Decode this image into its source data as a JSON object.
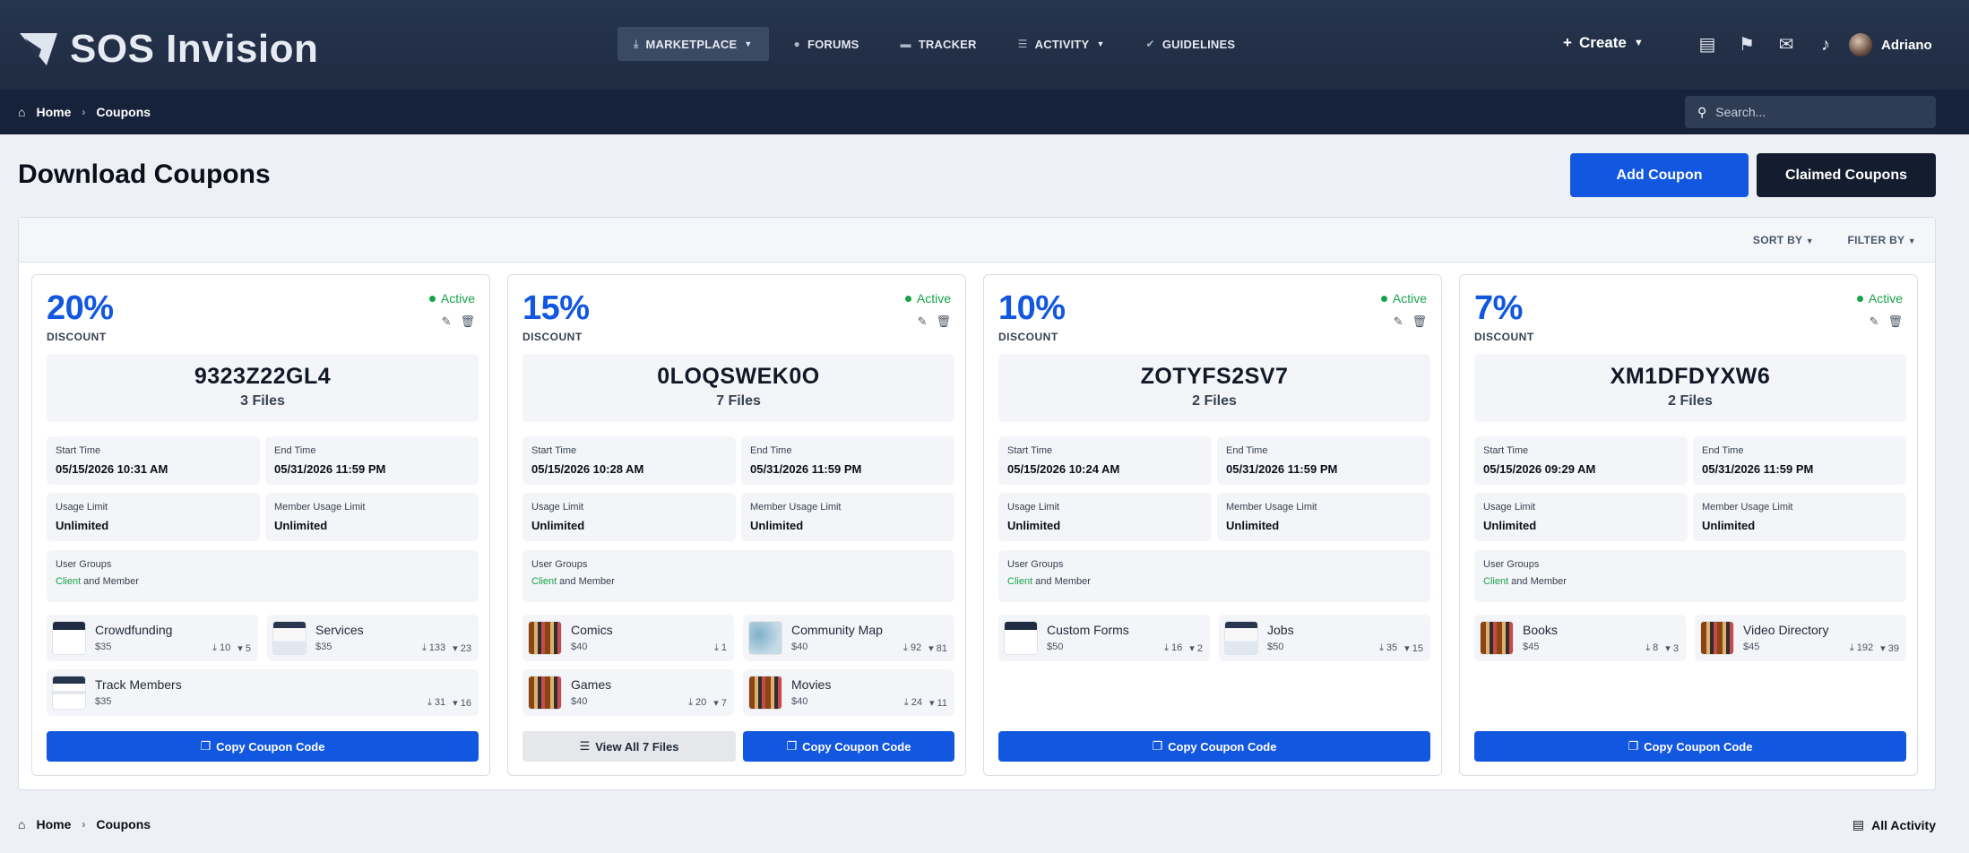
{
  "header": {
    "brand": "SOS Invision",
    "nav": [
      {
        "label": "MARKETPLACE",
        "icon": "download-icon",
        "has_caret": true
      },
      {
        "label": "FORUMS",
        "icon": "comment-icon",
        "has_caret": false
      },
      {
        "label": "TRACKER",
        "icon": "folder-icon",
        "has_caret": false
      },
      {
        "label": "ACTIVITY",
        "icon": "list-icon",
        "has_caret": true
      },
      {
        "label": "GUIDELINES",
        "icon": "check-badge-icon",
        "has_caret": false
      }
    ],
    "create_label": "Create",
    "user_name": "Adriano"
  },
  "breadcrumb": {
    "home": "Home",
    "current": "Coupons"
  },
  "search": {
    "placeholder": "Search..."
  },
  "page": {
    "title": "Download Coupons",
    "add_label": "Add Coupon",
    "claimed_label": "Claimed Coupons"
  },
  "toolbar": {
    "sort_label": "SORT BY",
    "filter_label": "FILTER BY"
  },
  "labels": {
    "discount": "DISCOUNT",
    "start_time": "Start Time",
    "end_time": "End Time",
    "usage_limit": "Usage Limit",
    "member_usage_limit": "Member Usage Limit",
    "user_groups": "User Groups",
    "groups_client": "Client",
    "groups_rest": " and Member",
    "copy": "Copy Coupon Code",
    "view_all": "View All 7 Files"
  },
  "coupons": [
    {
      "percent": "20%",
      "status": "Active",
      "code": "9323Z22GL4",
      "files": "3 Files",
      "start": "05/15/2026 10:31 AM",
      "end": "05/31/2026 11:59 PM",
      "usage": "Unlimited",
      "member_usage": "Unlimited",
      "items": [
        {
          "name": "Crowdfunding",
          "price": "$35",
          "downloads": "10",
          "purchases": "5"
        },
        {
          "name": "Services",
          "price": "$35",
          "downloads": "133",
          "purchases": "23"
        },
        {
          "name": "Track Members",
          "price": "$35",
          "downloads": "31",
          "purchases": "16"
        }
      ]
    },
    {
      "percent": "15%",
      "status": "Active",
      "code": "0LOQSWEK0O",
      "files": "7 Files",
      "start": "05/15/2026 10:28 AM",
      "end": "05/31/2026 11:59 PM",
      "usage": "Unlimited",
      "member_usage": "Unlimited",
      "items": [
        {
          "name": "Comics",
          "price": "$40",
          "downloads": "1",
          "purchases": ""
        },
        {
          "name": "Community Map",
          "price": "$40",
          "downloads": "92",
          "purchases": "81"
        },
        {
          "name": "Games",
          "price": "$40",
          "downloads": "20",
          "purchases": "7"
        },
        {
          "name": "Movies",
          "price": "$40",
          "downloads": "24",
          "purchases": "11"
        }
      ]
    },
    {
      "percent": "10%",
      "status": "Active",
      "code": "ZOTYFS2SV7",
      "files": "2 Files",
      "start": "05/15/2026 10:24 AM",
      "end": "05/31/2026 11:59 PM",
      "usage": "Unlimited",
      "member_usage": "Unlimited",
      "items": [
        {
          "name": "Custom Forms",
          "price": "$50",
          "downloads": "16",
          "purchases": "2"
        },
        {
          "name": "Jobs",
          "price": "$50",
          "downloads": "35",
          "purchases": "15"
        }
      ]
    },
    {
      "percent": "7%",
      "status": "Active",
      "code": "XM1DFDYXW6",
      "files": "2 Files",
      "start": "05/15/2026 09:29 AM",
      "end": "05/31/2026 11:59 PM",
      "usage": "Unlimited",
      "member_usage": "Unlimited",
      "items": [
        {
          "name": "Books",
          "price": "$45",
          "downloads": "8",
          "purchases": "3"
        },
        {
          "name": "Video Directory",
          "price": "$45",
          "downloads": "192",
          "purchases": "39"
        }
      ]
    }
  ],
  "footer": {
    "all_activity": "All Activity"
  },
  "colors": {
    "accent": "#1257e0",
    "active": "#16a34a",
    "header_bg": "#26344d"
  }
}
